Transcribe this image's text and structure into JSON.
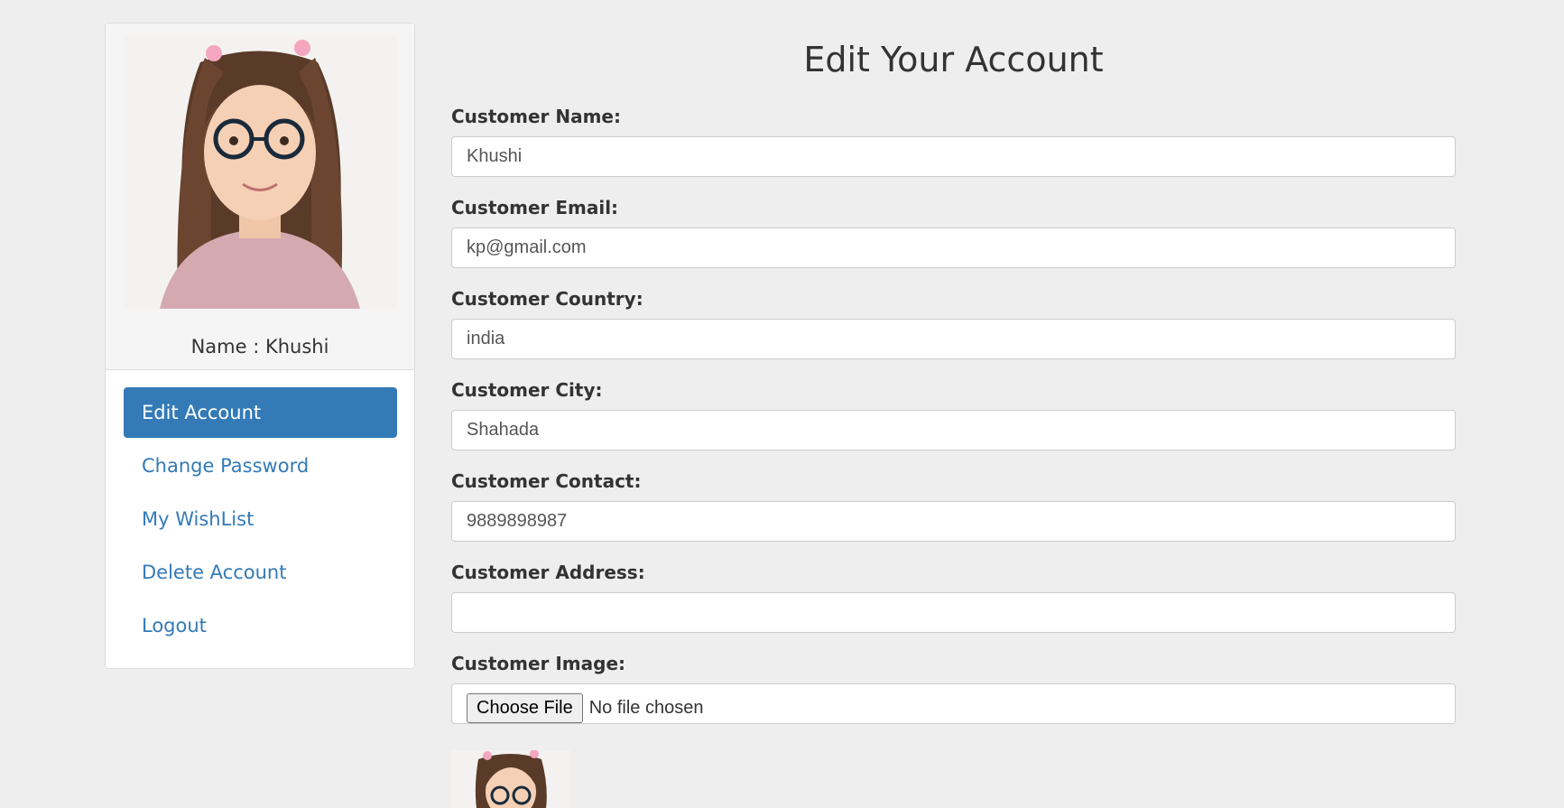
{
  "profile": {
    "name_label": "Name : Khushi"
  },
  "menu": {
    "items": [
      {
        "label": "Edit Account",
        "active": true
      },
      {
        "label": "Change Password",
        "active": false
      },
      {
        "label": "My WishList",
        "active": false
      },
      {
        "label": "Delete Account",
        "active": false
      },
      {
        "label": "Logout",
        "active": false
      }
    ]
  },
  "form": {
    "title": "Edit Your Account",
    "fields": [
      {
        "label": "Customer Name:",
        "value": "Khushi"
      },
      {
        "label": "Customer Email:",
        "value": "kp@gmail.com"
      },
      {
        "label": "Customer Country:",
        "value": "india"
      },
      {
        "label": "Customer City:",
        "value": "Shahada"
      },
      {
        "label": "Customer Contact:",
        "value": "9889898987"
      },
      {
        "label": "Customer Address:",
        "value": ""
      }
    ],
    "image_field": {
      "label": "Customer Image:",
      "button_label": "Choose File",
      "status": "No file chosen"
    }
  },
  "colors": {
    "accent": "#337ab7",
    "background": "#eeeeee"
  }
}
